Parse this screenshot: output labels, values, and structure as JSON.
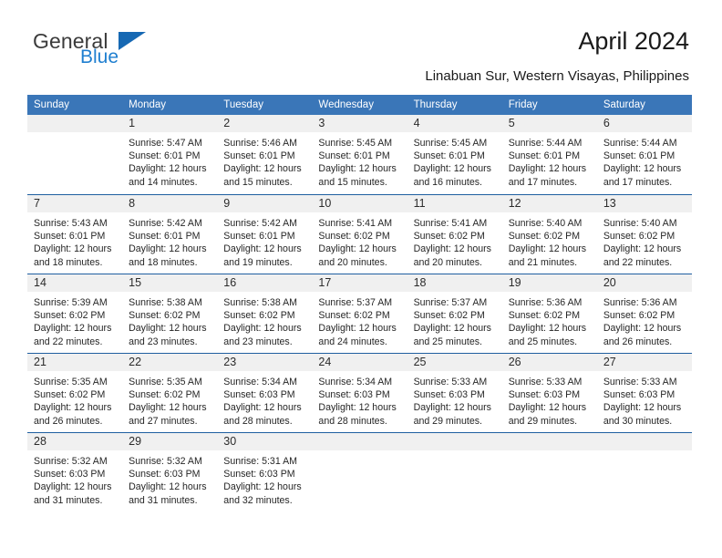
{
  "brand": {
    "name_general": "General",
    "name_blue": "Blue",
    "triangle_color": "#1668b3",
    "blue_text_color": "#1f7fd0"
  },
  "header": {
    "title": "April 2024",
    "subtitle": "Linabuan Sur, Western Visayas, Philippines",
    "accent_color": "#3a76b8",
    "separator_color": "#1f5fa0",
    "daynum_band_color": "#f0f0f0"
  },
  "weekdays": [
    "Sunday",
    "Monday",
    "Tuesday",
    "Wednesday",
    "Thursday",
    "Friday",
    "Saturday"
  ],
  "weeks": [
    [
      {
        "day": "",
        "sunrise": "",
        "sunset": "",
        "daylight1": "",
        "daylight2": "",
        "empty": true
      },
      {
        "day": "1",
        "sunrise": "Sunrise: 5:47 AM",
        "sunset": "Sunset: 6:01 PM",
        "daylight1": "Daylight: 12 hours",
        "daylight2": "and 14 minutes."
      },
      {
        "day": "2",
        "sunrise": "Sunrise: 5:46 AM",
        "sunset": "Sunset: 6:01 PM",
        "daylight1": "Daylight: 12 hours",
        "daylight2": "and 15 minutes."
      },
      {
        "day": "3",
        "sunrise": "Sunrise: 5:45 AM",
        "sunset": "Sunset: 6:01 PM",
        "daylight1": "Daylight: 12 hours",
        "daylight2": "and 15 minutes."
      },
      {
        "day": "4",
        "sunrise": "Sunrise: 5:45 AM",
        "sunset": "Sunset: 6:01 PM",
        "daylight1": "Daylight: 12 hours",
        "daylight2": "and 16 minutes."
      },
      {
        "day": "5",
        "sunrise": "Sunrise: 5:44 AM",
        "sunset": "Sunset: 6:01 PM",
        "daylight1": "Daylight: 12 hours",
        "daylight2": "and 17 minutes."
      },
      {
        "day": "6",
        "sunrise": "Sunrise: 5:44 AM",
        "sunset": "Sunset: 6:01 PM",
        "daylight1": "Daylight: 12 hours",
        "daylight2": "and 17 minutes."
      }
    ],
    [
      {
        "day": "7",
        "sunrise": "Sunrise: 5:43 AM",
        "sunset": "Sunset: 6:01 PM",
        "daylight1": "Daylight: 12 hours",
        "daylight2": "and 18 minutes."
      },
      {
        "day": "8",
        "sunrise": "Sunrise: 5:42 AM",
        "sunset": "Sunset: 6:01 PM",
        "daylight1": "Daylight: 12 hours",
        "daylight2": "and 18 minutes."
      },
      {
        "day": "9",
        "sunrise": "Sunrise: 5:42 AM",
        "sunset": "Sunset: 6:01 PM",
        "daylight1": "Daylight: 12 hours",
        "daylight2": "and 19 minutes."
      },
      {
        "day": "10",
        "sunrise": "Sunrise: 5:41 AM",
        "sunset": "Sunset: 6:02 PM",
        "daylight1": "Daylight: 12 hours",
        "daylight2": "and 20 minutes."
      },
      {
        "day": "11",
        "sunrise": "Sunrise: 5:41 AM",
        "sunset": "Sunset: 6:02 PM",
        "daylight1": "Daylight: 12 hours",
        "daylight2": "and 20 minutes."
      },
      {
        "day": "12",
        "sunrise": "Sunrise: 5:40 AM",
        "sunset": "Sunset: 6:02 PM",
        "daylight1": "Daylight: 12 hours",
        "daylight2": "and 21 minutes."
      },
      {
        "day": "13",
        "sunrise": "Sunrise: 5:40 AM",
        "sunset": "Sunset: 6:02 PM",
        "daylight1": "Daylight: 12 hours",
        "daylight2": "and 22 minutes."
      }
    ],
    [
      {
        "day": "14",
        "sunrise": "Sunrise: 5:39 AM",
        "sunset": "Sunset: 6:02 PM",
        "daylight1": "Daylight: 12 hours",
        "daylight2": "and 22 minutes."
      },
      {
        "day": "15",
        "sunrise": "Sunrise: 5:38 AM",
        "sunset": "Sunset: 6:02 PM",
        "daylight1": "Daylight: 12 hours",
        "daylight2": "and 23 minutes."
      },
      {
        "day": "16",
        "sunrise": "Sunrise: 5:38 AM",
        "sunset": "Sunset: 6:02 PM",
        "daylight1": "Daylight: 12 hours",
        "daylight2": "and 23 minutes."
      },
      {
        "day": "17",
        "sunrise": "Sunrise: 5:37 AM",
        "sunset": "Sunset: 6:02 PM",
        "daylight1": "Daylight: 12 hours",
        "daylight2": "and 24 minutes."
      },
      {
        "day": "18",
        "sunrise": "Sunrise: 5:37 AM",
        "sunset": "Sunset: 6:02 PM",
        "daylight1": "Daylight: 12 hours",
        "daylight2": "and 25 minutes."
      },
      {
        "day": "19",
        "sunrise": "Sunrise: 5:36 AM",
        "sunset": "Sunset: 6:02 PM",
        "daylight1": "Daylight: 12 hours",
        "daylight2": "and 25 minutes."
      },
      {
        "day": "20",
        "sunrise": "Sunrise: 5:36 AM",
        "sunset": "Sunset: 6:02 PM",
        "daylight1": "Daylight: 12 hours",
        "daylight2": "and 26 minutes."
      }
    ],
    [
      {
        "day": "21",
        "sunrise": "Sunrise: 5:35 AM",
        "sunset": "Sunset: 6:02 PM",
        "daylight1": "Daylight: 12 hours",
        "daylight2": "and 26 minutes."
      },
      {
        "day": "22",
        "sunrise": "Sunrise: 5:35 AM",
        "sunset": "Sunset: 6:02 PM",
        "daylight1": "Daylight: 12 hours",
        "daylight2": "and 27 minutes."
      },
      {
        "day": "23",
        "sunrise": "Sunrise: 5:34 AM",
        "sunset": "Sunset: 6:03 PM",
        "daylight1": "Daylight: 12 hours",
        "daylight2": "and 28 minutes."
      },
      {
        "day": "24",
        "sunrise": "Sunrise: 5:34 AM",
        "sunset": "Sunset: 6:03 PM",
        "daylight1": "Daylight: 12 hours",
        "daylight2": "and 28 minutes."
      },
      {
        "day": "25",
        "sunrise": "Sunrise: 5:33 AM",
        "sunset": "Sunset: 6:03 PM",
        "daylight1": "Daylight: 12 hours",
        "daylight2": "and 29 minutes."
      },
      {
        "day": "26",
        "sunrise": "Sunrise: 5:33 AM",
        "sunset": "Sunset: 6:03 PM",
        "daylight1": "Daylight: 12 hours",
        "daylight2": "and 29 minutes."
      },
      {
        "day": "27",
        "sunrise": "Sunrise: 5:33 AM",
        "sunset": "Sunset: 6:03 PM",
        "daylight1": "Daylight: 12 hours",
        "daylight2": "and 30 minutes."
      }
    ],
    [
      {
        "day": "28",
        "sunrise": "Sunrise: 5:32 AM",
        "sunset": "Sunset: 6:03 PM",
        "daylight1": "Daylight: 12 hours",
        "daylight2": "and 31 minutes."
      },
      {
        "day": "29",
        "sunrise": "Sunrise: 5:32 AM",
        "sunset": "Sunset: 6:03 PM",
        "daylight1": "Daylight: 12 hours",
        "daylight2": "and 31 minutes."
      },
      {
        "day": "30",
        "sunrise": "Sunrise: 5:31 AM",
        "sunset": "Sunset: 6:03 PM",
        "daylight1": "Daylight: 12 hours",
        "daylight2": "and 32 minutes."
      },
      {
        "day": "",
        "sunrise": "",
        "sunset": "",
        "daylight1": "",
        "daylight2": "",
        "empty": true
      },
      {
        "day": "",
        "sunrise": "",
        "sunset": "",
        "daylight1": "",
        "daylight2": "",
        "empty": true
      },
      {
        "day": "",
        "sunrise": "",
        "sunset": "",
        "daylight1": "",
        "daylight2": "",
        "empty": true
      },
      {
        "day": "",
        "sunrise": "",
        "sunset": "",
        "daylight1": "",
        "daylight2": "",
        "empty": true
      }
    ]
  ]
}
